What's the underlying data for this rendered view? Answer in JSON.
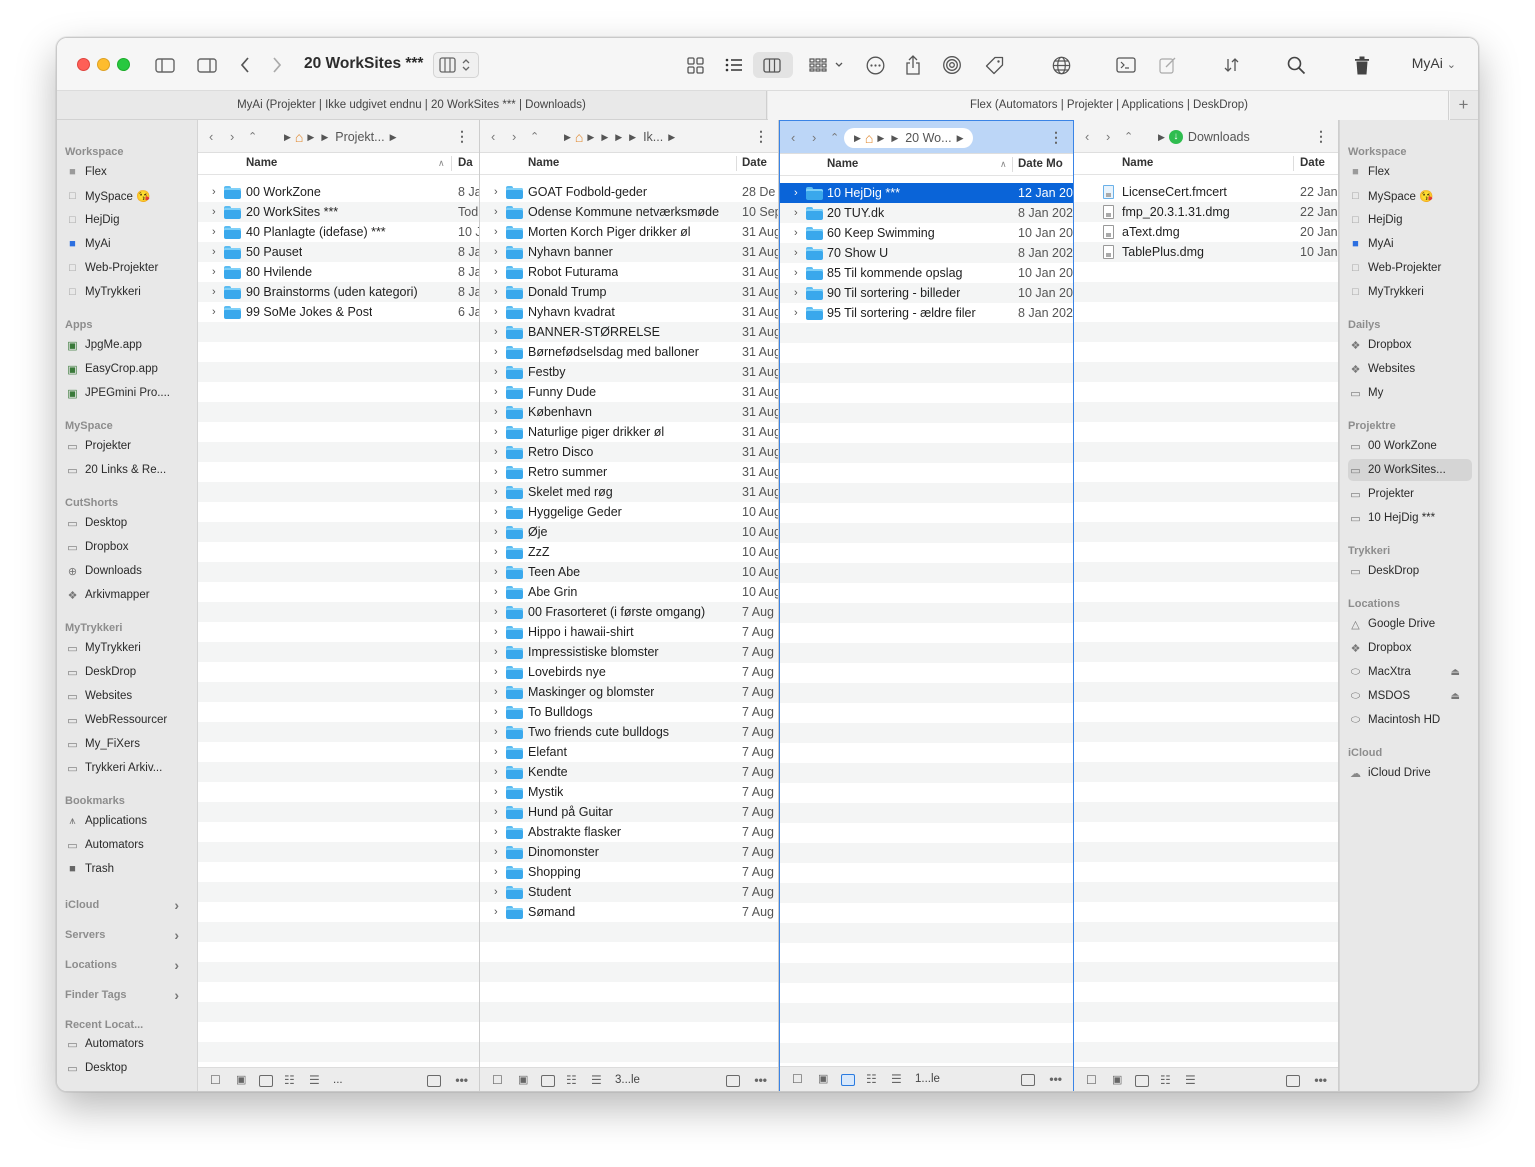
{
  "window": {
    "title": "20 WorkSites ***",
    "account": "MyAi"
  },
  "tabs": [
    {
      "label": "MyAi (Projekter | Ikke udgivet endnu | 20 WorkSites *** | Downloads)"
    },
    {
      "label": "Flex (Automators | Projekter | Applications | DeskDrop)"
    }
  ],
  "sidebar_left": {
    "sections": [
      {
        "header": "Workspace",
        "items": [
          {
            "label": "Flex",
            "icon": "grey-square-tag-icon"
          },
          {
            "label": "MySpace 😘",
            "icon": "empty-square-tag-icon"
          },
          {
            "label": "HejDig",
            "icon": "empty-square-tag-icon"
          },
          {
            "label": "MyAi",
            "icon": "blue-square-tag-icon"
          },
          {
            "label": "Web-Projekter",
            "icon": "empty-square-tag-icon"
          },
          {
            "label": "MyTrykkeri",
            "icon": "empty-square-tag-icon"
          }
        ]
      },
      {
        "header": "Apps",
        "items": [
          {
            "label": "JpgMe.app",
            "icon": "app-icon"
          },
          {
            "label": "EasyCrop.app",
            "icon": "app-icon"
          },
          {
            "label": "JPEGmini Pro....",
            "icon": "app-icon"
          }
        ]
      },
      {
        "header": "MySpace",
        "items": [
          {
            "label": "Projekter",
            "icon": "folder-icon"
          },
          {
            "label": "20 Links & Re...",
            "icon": "folder-icon"
          }
        ]
      },
      {
        "header": "CutShorts",
        "items": [
          {
            "label": "Desktop",
            "icon": "desktop-icon"
          },
          {
            "label": "Dropbox",
            "icon": "folder-icon"
          },
          {
            "label": "Downloads",
            "icon": "download-icon"
          },
          {
            "label": "Arkivmapper",
            "icon": "dropbox-icon"
          }
        ]
      },
      {
        "header": "MyTrykkeri",
        "items": [
          {
            "label": "MyTrykkeri",
            "icon": "folder-icon"
          },
          {
            "label": "DeskDrop",
            "icon": "folder-icon"
          },
          {
            "label": "Websites",
            "icon": "folder-icon"
          },
          {
            "label": "WebRessourcer",
            "icon": "folder-icon"
          },
          {
            "label": "My_FiXers",
            "icon": "folder-icon"
          },
          {
            "label": "Trykkeri Arkiv...",
            "icon": "folder-icon"
          }
        ]
      },
      {
        "header": "Bookmarks",
        "items": [
          {
            "label": "Applications",
            "icon": "applications-icon"
          },
          {
            "label": "Automators",
            "icon": "folder-icon"
          },
          {
            "label": "Trash",
            "icon": "trash-icon"
          }
        ]
      }
    ],
    "collapsed": [
      "iCloud",
      "Servers",
      "Locations",
      "Finder Tags"
    ],
    "recent": {
      "header": "Recent Locat...",
      "items": [
        {
          "label": "Automators",
          "icon": "folder-icon"
        },
        {
          "label": "Desktop",
          "icon": "desktop-icon"
        }
      ]
    }
  },
  "sidebar_right": {
    "sections": [
      {
        "header": "Workspace",
        "items": [
          {
            "label": "Flex",
            "icon": "grey-square-tag-icon"
          },
          {
            "label": "MySpace 😘",
            "icon": "empty-square-tag-icon"
          },
          {
            "label": "HejDig",
            "icon": "empty-square-tag-icon"
          },
          {
            "label": "MyAi",
            "icon": "blue-square-tag-icon"
          },
          {
            "label": "Web-Projekter",
            "icon": "empty-square-tag-icon"
          },
          {
            "label": "MyTrykkeri",
            "icon": "empty-square-tag-icon"
          }
        ]
      },
      {
        "header": "Dailys",
        "items": [
          {
            "label": "Dropbox",
            "icon": "dropbox-icon"
          },
          {
            "label": "Websites",
            "icon": "dropbox-icon"
          },
          {
            "label": "My",
            "icon": "folder-icon"
          }
        ]
      },
      {
        "header": "Projektre",
        "items": [
          {
            "label": "00 WorkZone",
            "icon": "folder-icon"
          },
          {
            "label": "20 WorkSites...",
            "icon": "folder-icon",
            "selected": true
          },
          {
            "label": "Projekter",
            "icon": "folder-icon"
          },
          {
            "label": "10 HejDig ***",
            "icon": "folder-icon"
          }
        ]
      },
      {
        "header": "Trykkeri",
        "items": [
          {
            "label": "DeskDrop",
            "icon": "folder-icon"
          }
        ]
      },
      {
        "header": "Locations",
        "items": [
          {
            "label": "Google Drive",
            "icon": "drive-icon"
          },
          {
            "label": "Dropbox",
            "icon": "dropbox-icon"
          },
          {
            "label": "MacXtra",
            "icon": "disk-icon",
            "eject": true
          },
          {
            "label": "MSDOS",
            "icon": "disk-icon",
            "eject": true
          },
          {
            "label": "Macintosh HD",
            "icon": "disk-icon"
          }
        ]
      },
      {
        "header": "iCloud",
        "items": [
          {
            "label": "iCloud Drive",
            "icon": "cloud-icon"
          }
        ]
      }
    ]
  },
  "panes": [
    {
      "crumb": "Projekt...",
      "col_name": "Name",
      "col_date": "Da",
      "footer_text": "...",
      "rows": [
        {
          "name": "00 WorkZone",
          "date": "8 Ja"
        },
        {
          "name": "20 WorkSites ***",
          "date": "Tod"
        },
        {
          "name": "40 Planlagte (idefase) ***",
          "date": "10 J"
        },
        {
          "name": "50 Pauset",
          "date": "8 Ja"
        },
        {
          "name": "80 Hvilende",
          "date": "8 Ja"
        },
        {
          "name": "90 Brainstorms (uden kategori)",
          "date": "8 Ja"
        },
        {
          "name": "99 SoMe Jokes & Post",
          "date": "6 Ja"
        }
      ]
    },
    {
      "crumb": "Ik...",
      "col_name": "Name",
      "col_date": "Date",
      "footer_text": "3...le",
      "rows": [
        {
          "name": "GOAT Fodbold-geder",
          "date": "28 De"
        },
        {
          "name": "Odense Kommune netværksmøde",
          "date": "10 Sep"
        },
        {
          "name": "Morten Korch Piger drikker øl",
          "date": "31 Aug"
        },
        {
          "name": "Nyhavn banner",
          "date": "31 Aug"
        },
        {
          "name": "Robot Futurama",
          "date": "31 Aug"
        },
        {
          "name": "Donald Trump",
          "date": "31 Aug"
        },
        {
          "name": "Nyhavn kvadrat",
          "date": "31 Aug"
        },
        {
          "name": "BANNER-STØRRELSE",
          "date": "31 Aug"
        },
        {
          "name": "Børnefødselsdag med balloner",
          "date": "31 Aug"
        },
        {
          "name": "Festby",
          "date": "31 Aug"
        },
        {
          "name": "Funny Dude",
          "date": "31 Aug"
        },
        {
          "name": "København",
          "date": "31 Aug"
        },
        {
          "name": "Naturlige piger drikker øl",
          "date": "31 Aug"
        },
        {
          "name": "Retro Disco",
          "date": "31 Aug"
        },
        {
          "name": "Retro summer",
          "date": "31 Aug"
        },
        {
          "name": "Skelet med røg",
          "date": "31 Aug"
        },
        {
          "name": "Hyggelige Geder",
          "date": "10 Aug"
        },
        {
          "name": "Øje",
          "date": "10 Aug"
        },
        {
          "name": "ZzZ",
          "date": "10 Aug"
        },
        {
          "name": "Teen Abe",
          "date": "10 Aug"
        },
        {
          "name": "Abe Grin",
          "date": "10 Aug"
        },
        {
          "name": "00 Frasorteret (i første omgang)",
          "date": "7 Aug"
        },
        {
          "name": "Hippo i hawaii-shirt",
          "date": "7 Aug"
        },
        {
          "name": "Impressistiske blomster",
          "date": "7 Aug"
        },
        {
          "name": "Lovebirds nye",
          "date": "7 Aug"
        },
        {
          "name": "Maskinger og blomster",
          "date": "7 Aug"
        },
        {
          "name": "To Bulldogs",
          "date": "7 Aug"
        },
        {
          "name": "Two friends cute bulldogs",
          "date": "7 Aug"
        },
        {
          "name": "Elefant",
          "date": "7 Aug"
        },
        {
          "name": "Kendte",
          "date": "7 Aug"
        },
        {
          "name": "Mystik",
          "date": "7 Aug"
        },
        {
          "name": "Hund på Guitar",
          "date": "7 Aug"
        },
        {
          "name": "Abstrakte flasker",
          "date": "7 Aug"
        },
        {
          "name": "Dinomonster",
          "date": "7 Aug"
        },
        {
          "name": "Shopping",
          "date": "7 Aug"
        },
        {
          "name": "Student",
          "date": "7 Aug"
        },
        {
          "name": "Sømand",
          "date": "7 Aug"
        }
      ]
    },
    {
      "crumb": "20 Wo...",
      "col_name": "Name",
      "col_date": "Date Mo",
      "footer_text": "1...le",
      "rows": [
        {
          "name": "10 HejDig ***",
          "date": "12 Jan 20",
          "selected": true
        },
        {
          "name": "20 TUY.dk",
          "date": "8 Jan 202"
        },
        {
          "name": "60 Keep Swimming",
          "date": "10 Jan 20"
        },
        {
          "name": "70 Show U",
          "date": "8 Jan 202"
        },
        {
          "name": "85 Til kommende opslag",
          "date": "10 Jan 20"
        },
        {
          "name": "90 Til sortering - billeder",
          "date": "10 Jan 20"
        },
        {
          "name": "95 Til sortering - ældre filer",
          "date": "8 Jan 202"
        }
      ]
    },
    {
      "crumb": "Downloads",
      "col_name": "Name",
      "col_date": "Date",
      "footer_text": "",
      "rows": [
        {
          "name": "LicenseCert.fmcert",
          "date": "22 Jan",
          "kind": "cert"
        },
        {
          "name": "fmp_20.3.1.31.dmg",
          "date": "22 Jan",
          "kind": "file"
        },
        {
          "name": "aText.dmg",
          "date": "20 Jan",
          "kind": "file"
        },
        {
          "name": "TablePlus.dmg",
          "date": "10 Jan",
          "kind": "file"
        }
      ]
    }
  ]
}
